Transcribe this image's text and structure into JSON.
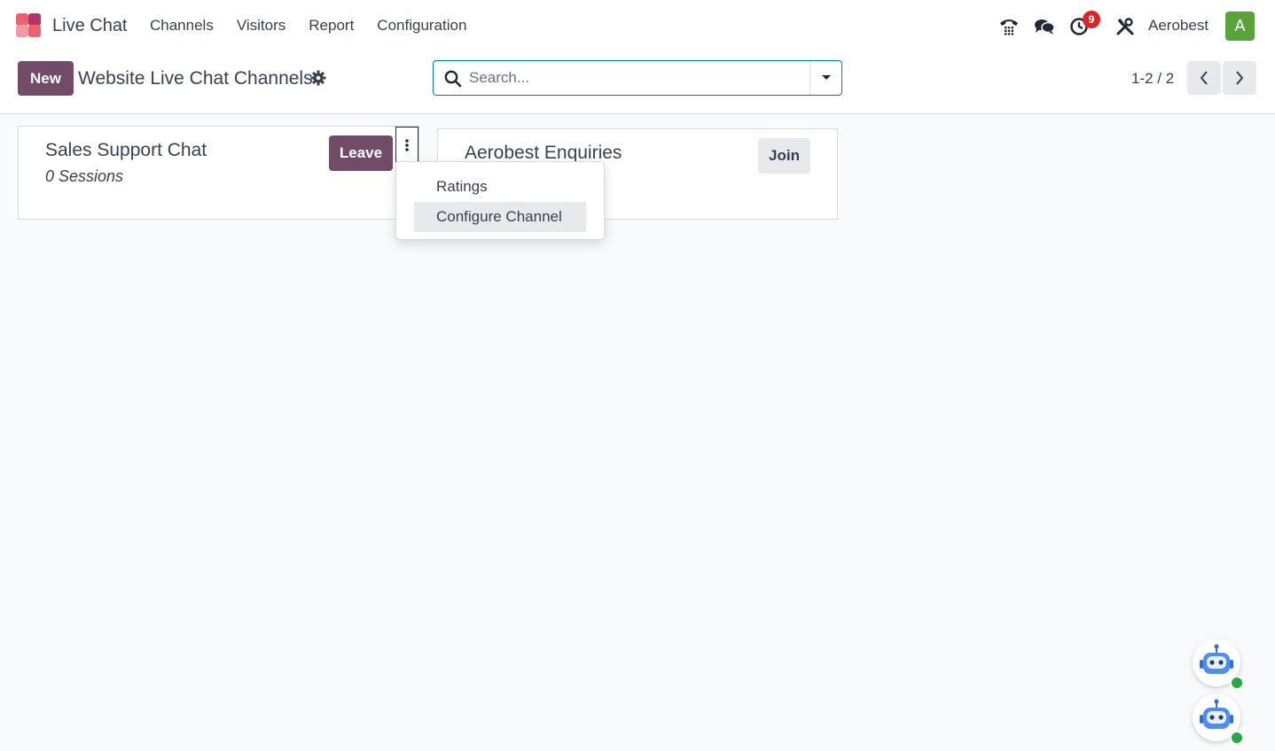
{
  "navbar": {
    "app_name": "Live Chat",
    "menu": [
      "Channels",
      "Visitors",
      "Report",
      "Configuration"
    ],
    "activity_count": "9",
    "company": "Aerobest",
    "avatar_letter": "A"
  },
  "control_panel": {
    "new_label": "New",
    "title": "Website Live Chat Channels",
    "search_placeholder": "Search...",
    "pager": "1-2 / 2"
  },
  "cards": [
    {
      "name": "Sales Support Chat",
      "sessions": "0 Sessions",
      "action": "Leave"
    },
    {
      "name": "Aerobest Enquiries",
      "action": "Join"
    }
  ],
  "dropdown": {
    "items": [
      "Ratings",
      "Configure Channel"
    ],
    "active": "Configure Channel"
  },
  "colors": {
    "primary": "#714b67",
    "accent": "#017e84",
    "badge": "#dc2626",
    "avatar": "#5aa33a",
    "online": "#28a745"
  }
}
